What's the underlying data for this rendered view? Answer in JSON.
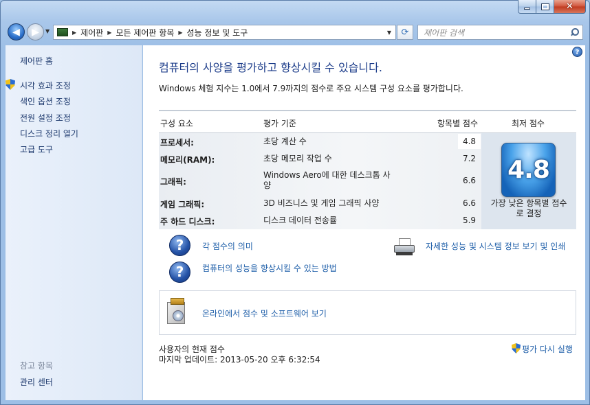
{
  "window": {
    "minimize_glyph": "",
    "maximize_glyph": "",
    "close_glyph": "✕"
  },
  "nav": {
    "back_glyph": "◀",
    "forward_glyph": "▶",
    "breadcrumbs": [
      "제어판",
      "모든 제어판 항목",
      "성능 정보 및 도구"
    ],
    "search_placeholder": "제어판 검색"
  },
  "sidebar": {
    "home": "제어판 홈",
    "items": [
      "시각 효과 조정",
      "색인 옵션 조정",
      "전원 설정 조정",
      "디스크 정리 열기",
      "고급 도구"
    ],
    "see_also": "참고 항목",
    "bottom_link": "관리 센터"
  },
  "main": {
    "title": "컴퓨터의 사양을 평가하고 향상시킬 수 있습니다.",
    "subtitle": "Windows 체험 지수는 1.0에서 7.9까지의 점수로 주요 시스템 구성 요소를 평가합니다.",
    "table": {
      "headers": {
        "component": "구성 요소",
        "rated": "평가 기준",
        "subscore": "항목별 점수",
        "base": "최저 점수"
      },
      "rows": [
        {
          "component": "프로세서:",
          "rated": "초당 계산 수",
          "score": "4.8"
        },
        {
          "component": "메모리(RAM):",
          "rated": "초당 메모리 작업 수",
          "score": "7.2"
        },
        {
          "component": "그래픽:",
          "rated": "Windows Aero에 대한 데스크톱 사양",
          "score": "6.6"
        },
        {
          "component": "게임 그래픽:",
          "rated": "3D 비즈니스 및 게임 그래픽 사양",
          "score": "6.6"
        },
        {
          "component": "주 하드 디스크:",
          "rated": "디스크 데이터 전송률",
          "score": "5.9"
        }
      ],
      "base_score": "4.8",
      "base_caption": "가장 낮은 항목별 점수로 결정"
    },
    "links": {
      "what_mean": "각 점수의 의미",
      "improve": "컴퓨터의 성능을 향상시킬 수 있는 방법",
      "print_details": "자세한 성능 및 시스템 정보 보기 및 인쇄",
      "online": "온라인에서 점수 및 소프트웨어 보기"
    },
    "footer": {
      "current_score": "사용자의 현재 점수",
      "last_update": "마지막 업데이트: 2013-05-20 오후 6:32:54",
      "rerun": "평가 다시 실행"
    }
  }
}
